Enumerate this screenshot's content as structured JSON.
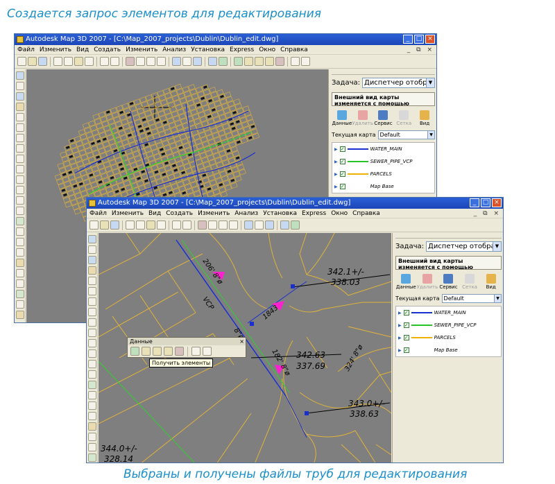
{
  "captions": {
    "top": "Создается запрос элементов для редактирования",
    "bottom": "Выбраны и получены файлы труб для редактирования"
  },
  "window": {
    "title": "Autodesk Map 3D 2007 - [C:\\Map_2007_projects\\Dublin\\Dublin_edit.dwg]",
    "minimize": "_",
    "maximize": "□",
    "close": "×",
    "mdi_controls": "_ ⧉ ×"
  },
  "menu": [
    "Файл",
    "Изменить",
    "Вид",
    "Создать",
    "Изменить",
    "Анализ",
    "Установка",
    "Express",
    "Окно",
    "Справка"
  ],
  "panel": {
    "task_label": "Задача:",
    "task_value": "Диспетчер отображения",
    "info_text": "Внешний вид карты изменяется с помощью стилей, тем, символов и поясне",
    "actions": [
      {
        "label": "Данные",
        "icon": "data-icon",
        "disabled": false,
        "color": "#5aa7e0"
      },
      {
        "label": "Удалить",
        "icon": "delete-icon",
        "disabled": true,
        "color": "#e8a3a3"
      },
      {
        "label": "Сервис",
        "icon": "tools-icon",
        "disabled": false,
        "color": "#4d7cc2"
      },
      {
        "label": "Сетка",
        "icon": "grid-icon",
        "disabled": true,
        "color": "#d8d8d8"
      },
      {
        "label": "Вид",
        "icon": "view-icon",
        "disabled": false,
        "color": "#e6b24a"
      }
    ],
    "current_map_label": "Текущая карта",
    "current_map_value": "Default",
    "layers": [
      {
        "name": "WATER_MAIN",
        "color": "#1a2fd0"
      },
      {
        "name": "SEWER_PIPE_VCP",
        "color": "#27c427"
      },
      {
        "name": "PARCELS",
        "color": "#f0b000"
      },
      {
        "name": "Map Base",
        "color": ""
      }
    ]
  },
  "floating_toolbar": {
    "title": "Данные",
    "close": "×",
    "tooltip": "Получить элементы"
  },
  "annotations": {
    "a1": "206' 8\"ø",
    "a2": "VCP",
    "a3": "342.1+/-",
    "a4": "338.03",
    "a5": "1843",
    "a6": "8\"ø",
    "a7": "342.63",
    "a8": "337.69",
    "a9": "182' 8\"ø",
    "a10": "343.0+/-",
    "a11": "338.63",
    "a12": "344.0+/-",
    "a13": "328.14",
    "a14": "324' 8\"ø"
  },
  "colors": {
    "parcel": "#e1b33a",
    "water": "#1a2fd0",
    "sewer": "#2fd12f",
    "canvas": "#7f7f7f"
  }
}
